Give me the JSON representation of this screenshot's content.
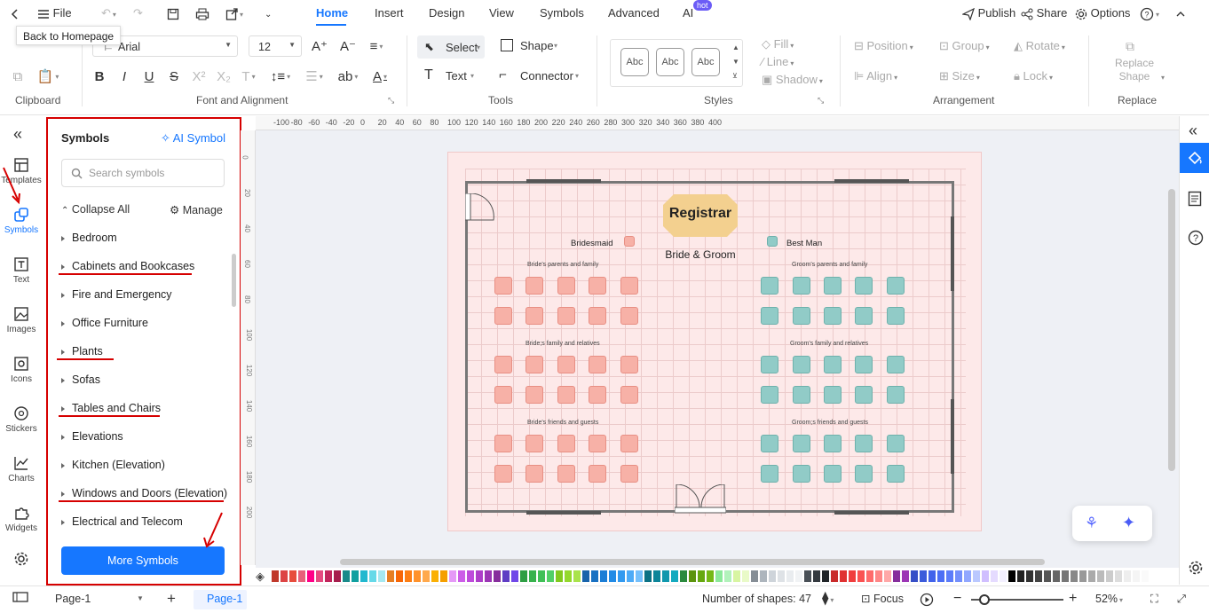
{
  "topbar": {
    "file_label": "File",
    "tabs": [
      {
        "label": "Home",
        "active": true
      },
      {
        "label": "Insert"
      },
      {
        "label": "Design"
      },
      {
        "label": "View"
      },
      {
        "label": "Symbols"
      },
      {
        "label": "Advanced"
      },
      {
        "label": "AI",
        "badge": "hot"
      }
    ],
    "publish_label": "Publish",
    "share_label": "Share",
    "options_label": "Options",
    "tooltip": "Back to Homepage"
  },
  "ribbon": {
    "font_name": "Arial",
    "font_size": "12",
    "select_label": "Select",
    "shape_label": "Shape",
    "text_label": "Text",
    "connector_label": "Connector",
    "style_samples": [
      "Abc",
      "Abc",
      "Abc"
    ],
    "fill_label": "Fill",
    "line_label": "Line",
    "shadow_label": "Shadow",
    "position_label": "Position",
    "group_label": "Group",
    "rotate_label": "Rotate",
    "align_label": "Align",
    "size_label": "Size",
    "lock_label": "Lock",
    "replace_shape_label": "Replace Shape",
    "groups": {
      "clipboard": "Clipboard",
      "font_alignment": "Font and Alignment",
      "tools": "Tools",
      "styles": "Styles",
      "arrangement": "Arrangement",
      "replace": "Replace"
    }
  },
  "rail": {
    "items": [
      "Templates",
      "Symbols",
      "Text",
      "Images",
      "Icons",
      "Stickers",
      "Charts",
      "Widgets"
    ]
  },
  "panel": {
    "title": "Symbols",
    "ai_symbol": "AI Symbol",
    "search_placeholder": "Search symbols",
    "collapse_all": "Collapse All",
    "manage": "Manage",
    "categories": [
      "Bedroom",
      "Cabinets and Bookcases",
      "Fire and Emergency",
      "Office Furniture",
      "Plants",
      "Sofas",
      "Tables and Chairs",
      "Elevations",
      "Kitchen (Elevation)",
      "Windows and Doors (Elevation)",
      "Electrical and Telecom"
    ],
    "more_symbols": "More Symbols"
  },
  "ruler": {
    "h_ticks": [
      "-100",
      "-80",
      "-60",
      "-40",
      "-20",
      "0",
      "20",
      "40",
      "60",
      "80",
      "100",
      "120",
      "140",
      "160",
      "180",
      "200",
      "220",
      "240",
      "260",
      "280",
      "300",
      "320",
      "340",
      "360",
      "380",
      "400"
    ],
    "v_ticks": [
      "0",
      "20",
      "40",
      "60",
      "80",
      "100",
      "120",
      "140",
      "160",
      "180",
      "200"
    ]
  },
  "diagram": {
    "registrar": "Registrar",
    "bride_groom": "Bride & Groom",
    "bridesmaid": "Bridesmaid",
    "best_man": "Best Man",
    "left_sections": [
      "Bride's parents and family",
      "Bride;s family and relatives",
      "Bride's friends and guests"
    ],
    "right_sections": [
      "Groom's parents and family",
      "Groom's family and relatives",
      "Groom;s friends and guests"
    ]
  },
  "status": {
    "page_select": "Page-1",
    "page_tab": "Page-1",
    "shapes_count": "Number of shapes: 47",
    "focus": "Focus",
    "zoom": "52%"
  },
  "colors": {
    "accent": "#1677ff",
    "annotation_red": "#d60000",
    "bride_chair": "#f7b1a7",
    "groom_chair": "#91cbc7",
    "registrar": "#f3d08f"
  }
}
